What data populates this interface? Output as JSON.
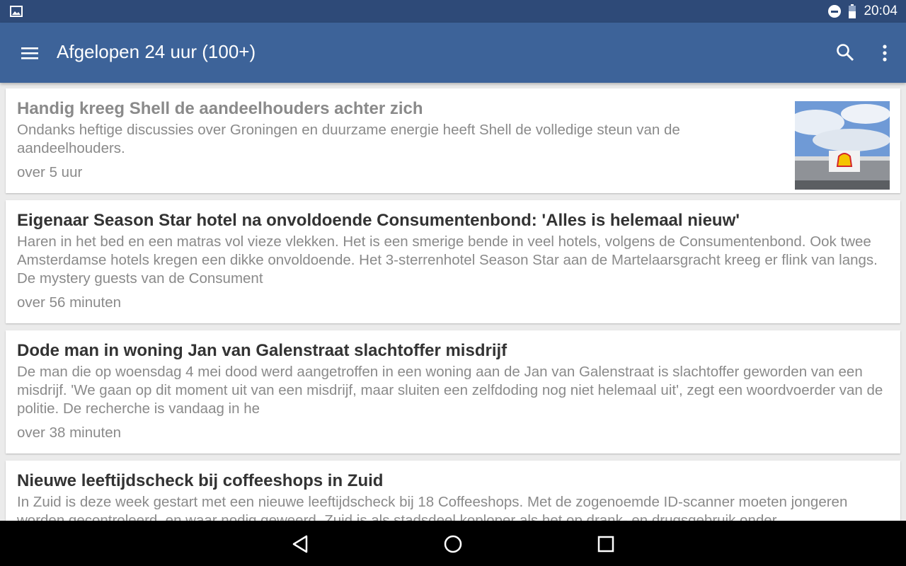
{
  "status_bar": {
    "time": "20:04"
  },
  "app_bar": {
    "title": "Afgelopen 24 uur (100+)"
  },
  "articles": [
    {
      "headline": "Handig kreeg Shell de aandeelhouders achter zich",
      "summary": "Ondanks heftige discussies over Groningen en duurzame energie heeft Shell de volledige steun van de aandeelhouders.",
      "time": "over 5 uur",
      "read": true,
      "thumbnail": "shell-logo-image"
    },
    {
      "headline": "Eigenaar Season Star hotel na onvoldoende Consumentenbond: 'Alles is helemaal nieuw'",
      "summary": "Haren in het bed en een matras vol vieze vlekken. Het is een smerige bende in veel hotels, volgens de Consumentenbond. Ook twee Amsterdamse hotels kregen een dikke onvoldoende. Het 3-sterrenhotel Season Star aan de Martelaarsgracht kreeg er flink van langs. De mystery guests van de Consument",
      "time": "over 56 minuten",
      "read": false
    },
    {
      "headline": "Dode man in woning Jan van Galenstraat slachtoffer misdrijf",
      "summary": "De man die op woensdag 4 mei dood werd aangetroffen in een woning aan de Jan van Galenstraat is slachtoffer geworden van een misdrijf. 'We gaan op dit moment uit van een misdrijf, maar sluiten een zelfdoding nog niet helemaal uit', zegt een woordvoerder van de politie. De recherche is vandaag in he",
      "time": "over 38 minuten",
      "read": false
    },
    {
      "headline": "Nieuwe leeftijdscheck bij coffeeshops in Zuid",
      "summary": "In Zuid is deze week gestart met een nieuwe leeftijdscheck bij 18 Coffeeshops. Met de zogenoemde ID-scanner moeten jongeren worden gecontroleerd, en waar nodig geweerd. Zuid is als stadsdeel koploper als het op drank- en drugsgebruik onder",
      "time": "",
      "read": false
    }
  ],
  "colors": {
    "status_bar": "#2e4a78",
    "app_bar": "#3d6399",
    "background": "#ebebeb"
  }
}
